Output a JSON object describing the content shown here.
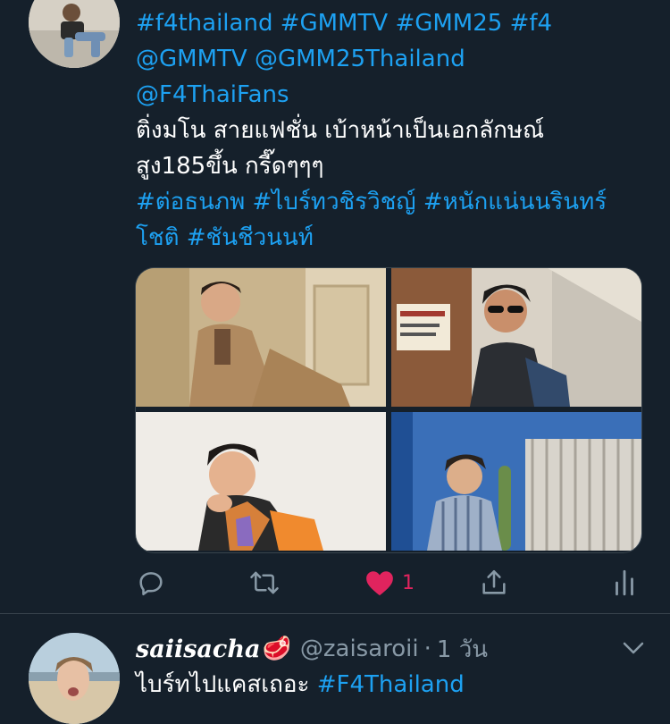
{
  "tweet1": {
    "line1": "#f4thailand #GMMTV #GMM25 #f4",
    "line2": "@GMMTV @GMM25Thailand",
    "line3": "@F4ThaiFans",
    "line4": "ติ่งมโน สายแฟชั่น เบ้าหน้าเป็นเอกลักษณ์",
    "line5": "สูง185ขึ้น กรี๊ดๆๆๆ",
    "line6": "#ต่อธนภพ #ไบร์ทวชิรวิชญ์ #หนักแน่นนรินทร์",
    "line7": "โชติ #ชันชีวนนท์",
    "media_count": 4,
    "like_count": "1",
    "liked": true
  },
  "tweet2": {
    "display_name": "saiisacha",
    "name_emoji": "🥩",
    "handle": "@zaisaroii",
    "separator": "·",
    "time": "1 วัน",
    "text_plain": "ไบร์ทไปแคสเถอะ ",
    "text_link": "#F4Thailand"
  },
  "colors": {
    "background": "#15202b",
    "link": "#1da1f2",
    "secondary": "#8899a6",
    "like": "#e0245e",
    "divider": "#38444d"
  },
  "icons": {
    "reply": "reply-icon",
    "retweet": "retweet-icon",
    "like": "heart-icon",
    "share": "share-icon",
    "analytics": "analytics-icon",
    "more": "chevron-down-icon"
  }
}
